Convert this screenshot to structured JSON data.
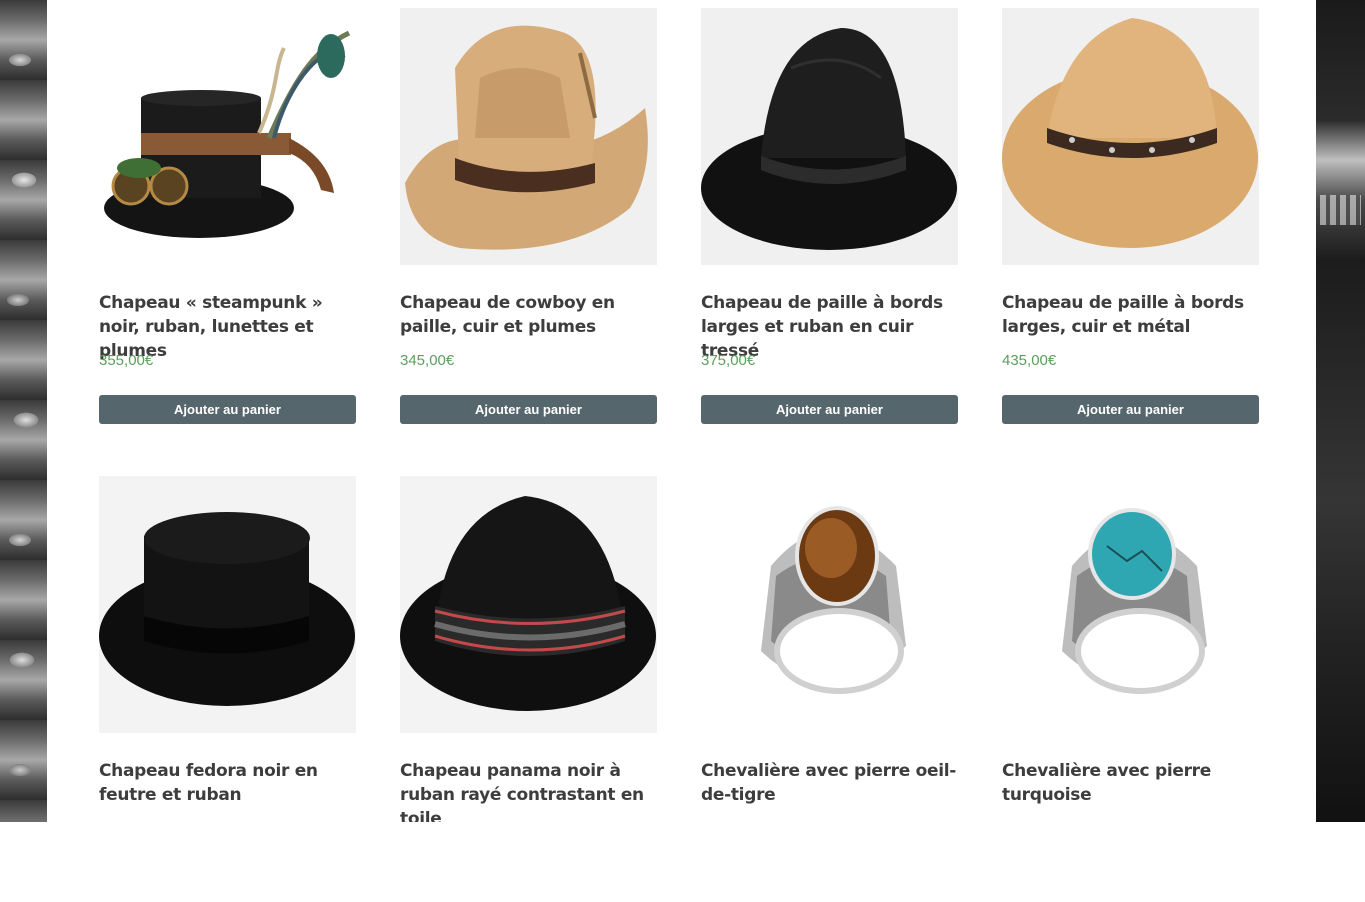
{
  "products": [
    {
      "title": "Chapeau « steampunk » noir, ruban, lunettes et plumes",
      "price": "355,00€",
      "button": "Ajouter au panier",
      "image": "steampunk-top-hat"
    },
    {
      "title": "Chapeau de cowboy en paille, cuir et plumes",
      "price": "345,00€",
      "button": "Ajouter au panier",
      "image": "straw-cowboy-hat"
    },
    {
      "title": "Chapeau de paille à bords larges et ruban en cuir tressé",
      "price": "375,00€",
      "button": "Ajouter au panier",
      "image": "black-wide-brim-straw-hat"
    },
    {
      "title": "Chapeau de paille à bords larges, cuir et métal",
      "price": "435,00€",
      "button": "Ajouter au panier",
      "image": "tan-wide-brim-straw-hat"
    },
    {
      "title": "Chapeau fedora noir en feutre et ruban",
      "image": "black-felt-boater-hat"
    },
    {
      "title": "Chapeau panama noir à ruban rayé contrastant en toile",
      "image": "black-panama-hat-striped-band"
    },
    {
      "title": "Chevalière avec pierre oeil-de-tigre",
      "image": "tigers-eye-signet-ring"
    },
    {
      "title": "Chevalière avec pierre turquoise",
      "image": "turquoise-signet-ring"
    }
  ]
}
